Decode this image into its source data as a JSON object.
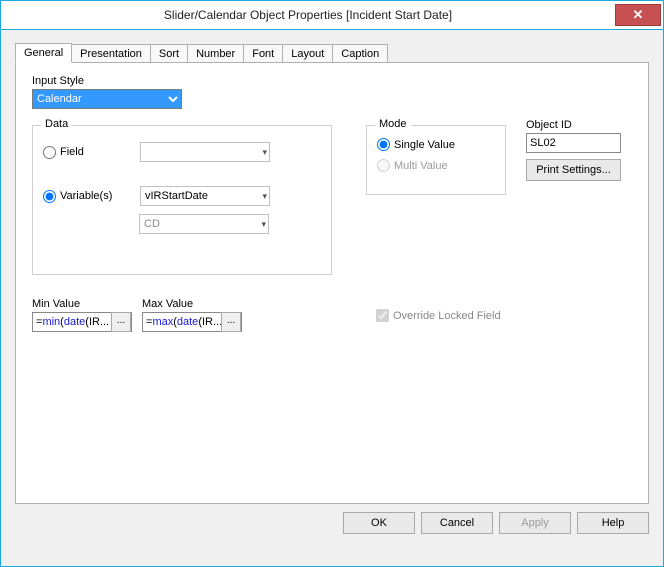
{
  "window": {
    "title": "Slider/Calendar Object Properties [Incident Start Date]",
    "close_glyph": "✕"
  },
  "tabs": [
    "General",
    "Presentation",
    "Sort",
    "Number",
    "Font",
    "Layout",
    "Caption"
  ],
  "general": {
    "input_style_label": "Input Style",
    "input_style_value": "Calendar",
    "data": {
      "legend": "Data",
      "field_label": "Field",
      "field_combo_value": "",
      "variables_label": "Variable(s)",
      "variable_primary": "vIRStartDate",
      "variable_secondary": "CD"
    },
    "mode": {
      "legend": "Mode",
      "single_label": "Single Value",
      "multi_label": "Multi Value"
    },
    "object_id": {
      "label": "Object ID",
      "value": "SL02",
      "print_btn": "Print Settings..."
    },
    "range": {
      "min_label": "Min Value",
      "min_fn": "min",
      "min_inner": "date",
      "min_tail": "IR...",
      "max_label": "Max Value",
      "max_fn": "max",
      "max_inner": "date",
      "max_tail": "IR...",
      "ellipsis": "..."
    },
    "override_label": "Override Locked Field"
  },
  "buttons": {
    "ok": "OK",
    "cancel": "Cancel",
    "apply": "Apply",
    "help": "Help"
  }
}
